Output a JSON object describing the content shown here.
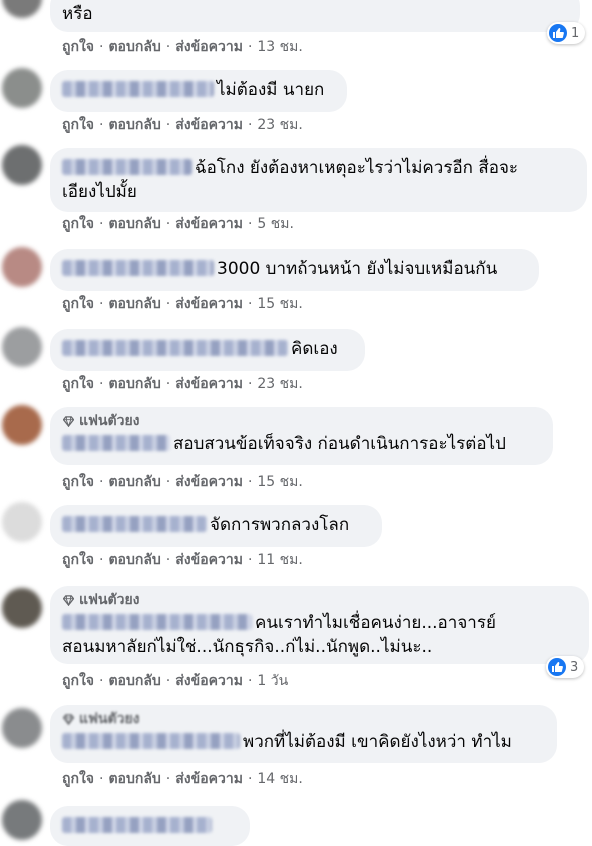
{
  "colors": {
    "bubble": "#f0f2f5",
    "meta": "#65676b",
    "like": "#1877f2"
  },
  "fan_badge_label": "แฟนตัวยง",
  "actions": {
    "like": "ถูกใจ",
    "reply": "ตอบกลับ",
    "message": "ส่งข้อความ",
    "separator": "·"
  },
  "comments": [
    {
      "text": "หรือ",
      "time": "13 ชม.",
      "reaction_count": "1"
    },
    {
      "text": "ไม่ต้องมี นายก",
      "time": "23 ชม."
    },
    {
      "text_line1": "ฉ้อโกง ยังต้องหาเหตุอะไรว่าไม่ควรอีก สื่อจะ",
      "text_line2": "เอียงไปมั้ย",
      "time": "5 ชม."
    },
    {
      "text": "3000 บาทถ้วนหน้า ยังไม่จบเหมือนกัน",
      "time": "15 ชม."
    },
    {
      "text": "คิดเอง",
      "time": "23 ชม."
    },
    {
      "text": "สอบสวนข้อเท็จจริง ก่อนดำเนินการอะไรต่อไป",
      "time": "15 ชม.",
      "fan_badge": true
    },
    {
      "text": "จัดการพวกลวงโลก",
      "time": "11 ชม."
    },
    {
      "text_line1": "คนเราทำไมเชื่อคนง่าย...อาจารย์",
      "text_line2": "สอนมหาลัยก่ไม่ใช่...นักธุรกิจ..ก่ไม่..นักพูด..ไม่นะ..",
      "time": "1 วัน",
      "fan_badge": true,
      "reaction_count": "3"
    },
    {
      "text": "พวกที่ไม่ต้องมี เขาคิดยังไงหว่า ทำไม",
      "time": "14 ชม.",
      "fan_badge": true
    }
  ]
}
